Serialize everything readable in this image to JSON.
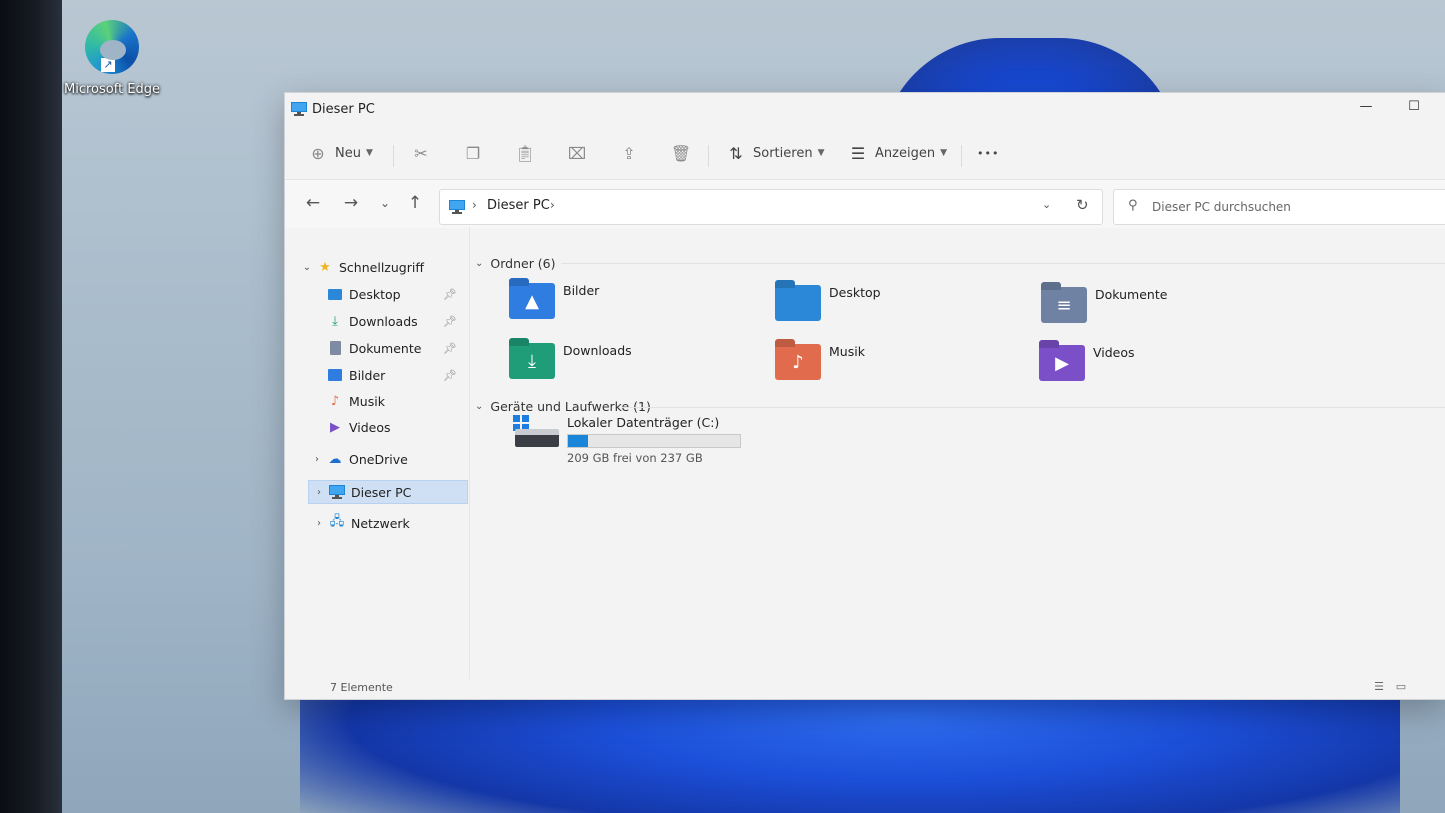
{
  "desktop": {
    "icons": [
      {
        "label": "Microsoft Edge",
        "icon": "edge-icon"
      }
    ]
  },
  "window": {
    "title": "Dieser PC",
    "controls": {
      "minimize": "—",
      "maximize": "☐"
    }
  },
  "commandbar": {
    "new_label": "Neu",
    "sort_label": "Sortieren",
    "view_label": "Anzeigen",
    "more_label": "•••"
  },
  "nav": {
    "back": "←",
    "forward": "→",
    "recent": "⌄",
    "up": "↑",
    "address": {
      "segments": [
        "Dieser PC"
      ]
    },
    "search_placeholder": "Dieser PC durchsuchen"
  },
  "sidebar": {
    "quick_access": "Schnellzugriff",
    "items": [
      {
        "label": "Desktop",
        "icon": "desktop-folder-icon",
        "pinned": true
      },
      {
        "label": "Downloads",
        "icon": "download-icon",
        "pinned": true
      },
      {
        "label": "Dokumente",
        "icon": "documents-icon",
        "pinned": true
      },
      {
        "label": "Bilder",
        "icon": "pictures-icon",
        "pinned": true
      },
      {
        "label": "Musik",
        "icon": "music-icon",
        "pinned": false
      },
      {
        "label": "Videos",
        "icon": "videos-icon",
        "pinned": false
      }
    ],
    "onedrive": "OneDrive",
    "thispc": "Dieser PC",
    "network": "Netzwerk"
  },
  "content": {
    "folders_header": "Ordner (6)",
    "folders": [
      {
        "label": "Bilder",
        "color": "#2f7de1",
        "icon": "pictures-icon"
      },
      {
        "label": "Desktop",
        "color": "#2b88d8",
        "icon": "desktop-folder-icon"
      },
      {
        "label": "Dokumente",
        "color": "#6f82a3",
        "icon": "documents-icon"
      },
      {
        "label": "Downloads",
        "color": "#1f9c78",
        "icon": "download-icon"
      },
      {
        "label": "Musik",
        "color": "#e06b4d",
        "icon": "music-icon"
      },
      {
        "label": "Videos",
        "color": "#7a4fc7",
        "icon": "videos-icon"
      }
    ],
    "drives_header": "Geräte und Laufwerke (1)",
    "drive": {
      "name": "Lokaler Datenträger (C:)",
      "free_text": "209 GB frei von 237 GB",
      "used_fraction": 0.118
    }
  },
  "status": {
    "items_text": "7 Elemente"
  },
  "colors": {
    "accent": "#1a86d9",
    "selection": "#cfe0f4"
  }
}
